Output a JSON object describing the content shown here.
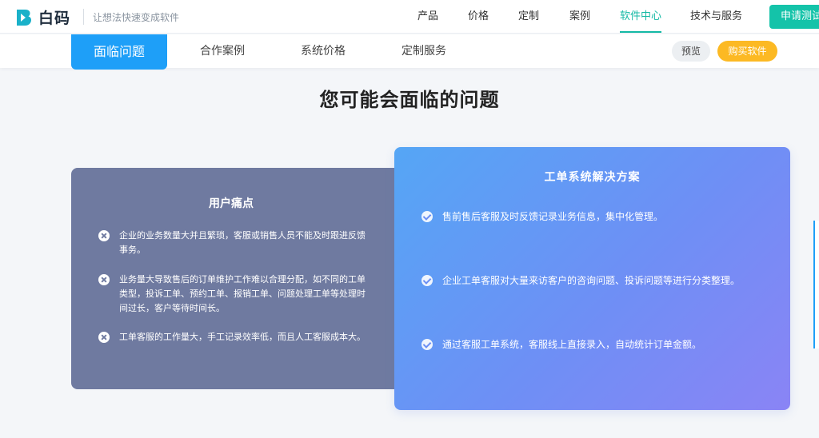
{
  "header": {
    "logo_text": "白码",
    "slogan": "让想法快速变成软件",
    "nav": [
      "产品",
      "价格",
      "定制",
      "案例",
      "软件中心",
      "技术与服务"
    ],
    "active_nav": "软件中心",
    "cta": "申请测试"
  },
  "subnav": {
    "tabs": [
      "面临问题",
      "合作案例",
      "系统价格",
      "定制服务"
    ],
    "active_tab": "面临问题",
    "preview": "预览",
    "buy": "购买软件"
  },
  "main": {
    "title": "您可能会面临的问题",
    "pain": {
      "title": "用户痛点",
      "items": [
        "企业的业务数量大并且繁琐，客服或销售人员不能及时跟进反馈事务。",
        "业务量大导致售后的订单维护工作难以合理分配，如不同的工单类型，投诉工单、预约工单、报销工单、问题处理工单等处理时间过长，客户等待时间长。",
        "工单客服的工作量大，手工记录效率低，而且人工客服成本大。"
      ]
    },
    "solution": {
      "title": "工单系统解决方案",
      "items": [
        "售前售后客服及时反馈记录业务信息，集中化管理。",
        "企业工单客服对大量来访客户的咨询问题、投诉问题等进行分类整理。",
        "通过客服工单系统，客服线上直接录入，自动统计订单金额。"
      ]
    }
  },
  "colors": {
    "accent": "#14b9a5",
    "tab_active": "#1e9ff8",
    "buy": "#fcb923",
    "pain_bg": "#6f7aa0"
  },
  "icons": {
    "pain_item": "x-circle-icon",
    "solution_item": "check-circle-icon"
  }
}
